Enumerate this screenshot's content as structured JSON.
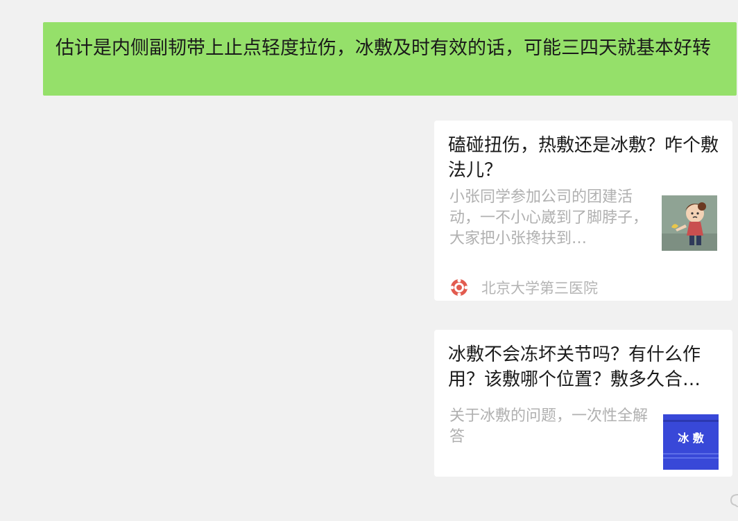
{
  "message": {
    "text": "估计是内侧副韧带上止点轻度拉伤，冰敷及时有效的话，可能三四天就基本好转"
  },
  "cards": [
    {
      "title": "磕碰扭伤，热敷还是冰敷？咋个敷法儿？",
      "description": "小张同学参加公司的团建活动，一不小心崴到了脚脖子，大家把小张搀扶到…",
      "source": "北京大学第三医院",
      "thumbnail_icon": "cartoon-injury-thumbnail",
      "source_icon": "hospital-logo-icon"
    },
    {
      "title": "冰敷不会冻坏关节吗？有什么作用？该敷哪个位置？敷多久合…",
      "description": "关于冰敷的问题，一次性全解答",
      "thumbnail_text": "冰 敷",
      "thumbnail_icon": "ice-compress-thumbnail"
    }
  ],
  "colors": {
    "background": "#f1f1f1",
    "sent_bubble": "#95e06a",
    "card": "#ffffff",
    "muted_text": "#b0b0b0",
    "thumb_blue": "#3848d8"
  }
}
